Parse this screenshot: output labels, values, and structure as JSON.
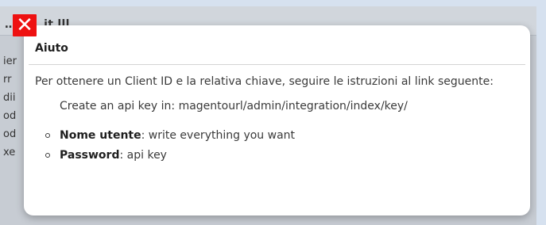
{
  "background": {
    "title": "…ll … it lll…",
    "lines": [
      "ier",
      "rr",
      "dii",
      "od",
      "od",
      "xe"
    ]
  },
  "close_button": {
    "icon": "close-icon",
    "glyph": "✕",
    "color": "#ee1111"
  },
  "modal": {
    "title": "Aiuto",
    "intro": "Per ottenere un Client ID e la relativa chiave, seguire le istruzioni al link seguente:",
    "api_line": "Create an api key in: magentourl/admin/integration/index/key/",
    "items": [
      {
        "label": "Nome utente",
        "text": ": write everything you want"
      },
      {
        "label": "Password",
        "text": ": api key"
      }
    ]
  }
}
